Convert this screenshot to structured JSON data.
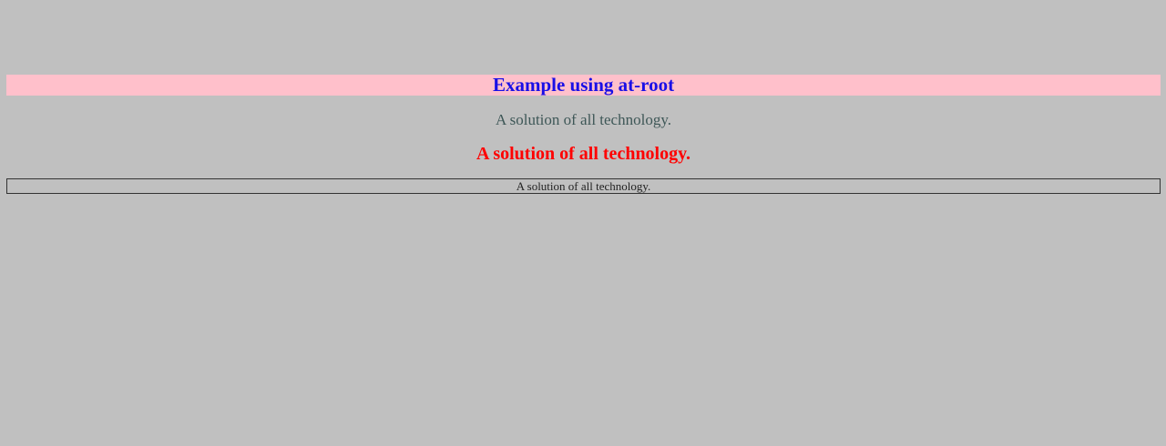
{
  "heading": {
    "text": "Example using at-root",
    "background": "#ffc0cb",
    "color": "#1a0fe6"
  },
  "lines": {
    "subtitle": "A solution of all technology.",
    "red": "A solution of all technology.",
    "boxed": "A solution of all technology."
  },
  "colors": {
    "page_background": "#c0c0c0",
    "subtitle": "#3e5757",
    "red": "#ff0000",
    "box_border": "#333333"
  }
}
